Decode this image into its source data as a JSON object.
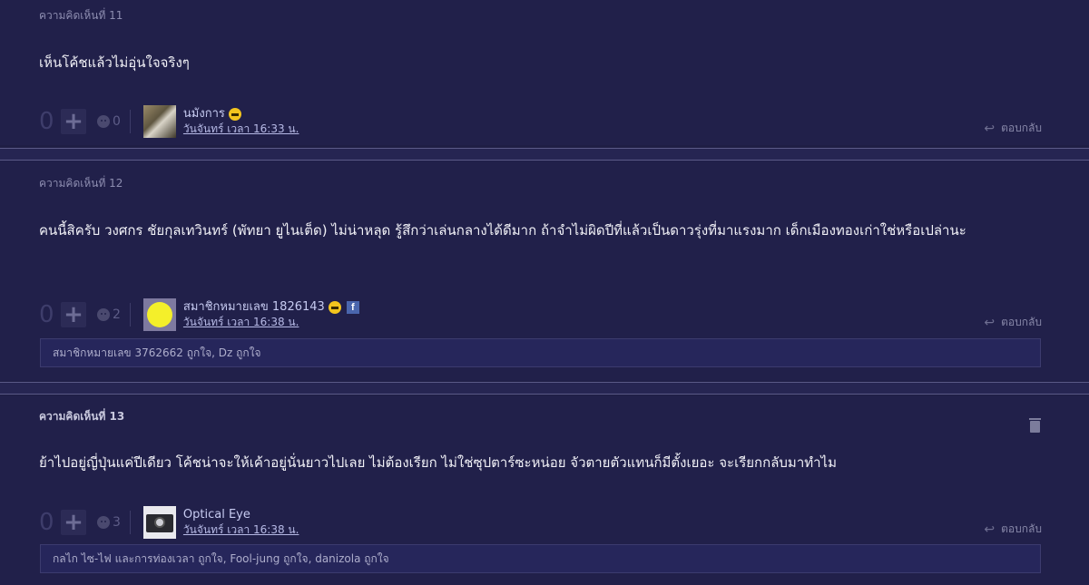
{
  "comments": [
    {
      "label": "ความคิดเห็นที่ 11",
      "text": "เห็นโค้ชแล้วไม่อุ่นใจจริงๆ",
      "votes": "0",
      "emotion_count": "0",
      "user": "นมังการ",
      "date": "วันจันทร์ เวลา 16:33 น.",
      "reply": "ตอบกลับ"
    },
    {
      "label": "ความคิดเห็นที่ 12",
      "text": "คนนี้สิครับ วงศกร ชัยกุลเทวินทร์ (พัทยา ยูไนเต็ด) ไม่น่าหลุด รู้สึกว่าเล่นกลางได้ดีมาก ถ้าจำไม่ผิดปีที่แล้วเป็นดาวรุ่งที่มาแรงมาก เด็กเมืองทองเก่าใช่หรือเปล่านะ",
      "votes": "0",
      "emotion_count": "2",
      "user": "สมาชิกหมายเลข 1826143",
      "date": "วันจันทร์ เวลา 16:38 น.",
      "reply": "ตอบกลับ",
      "likes": "สมาชิกหมายเลข 3762662 ถูกใจ, Dz ถูกใจ"
    },
    {
      "label": "ความคิดเห็นที่ 13",
      "text": "ย้าไปอยู่ญี่ปุ่นแค่ปีเดียว โค้ชน่าจะให้เค้าอยู่นั่นยาวไปเลย ไม่ต้องเรียก  ไม่ใช่ซุปตาร์ซะหน่อย จัวตายตัวแทนก็มีตั้งเยอะ จะเรียกกลับมาทำไม",
      "votes": "0",
      "emotion_count": "3",
      "user": "Optical Eye",
      "date": "วันจันทร์ เวลา 16:38 น.",
      "reply": "ตอบกลับ",
      "likes": "กลไก ไซ-ไฟ และการท่องเวลา ถูกใจ, Fool-jung ถูกใจ, danizola ถูกใจ"
    }
  ],
  "icons": {
    "plus": "+",
    "reply": "↩",
    "facebook": "f"
  }
}
